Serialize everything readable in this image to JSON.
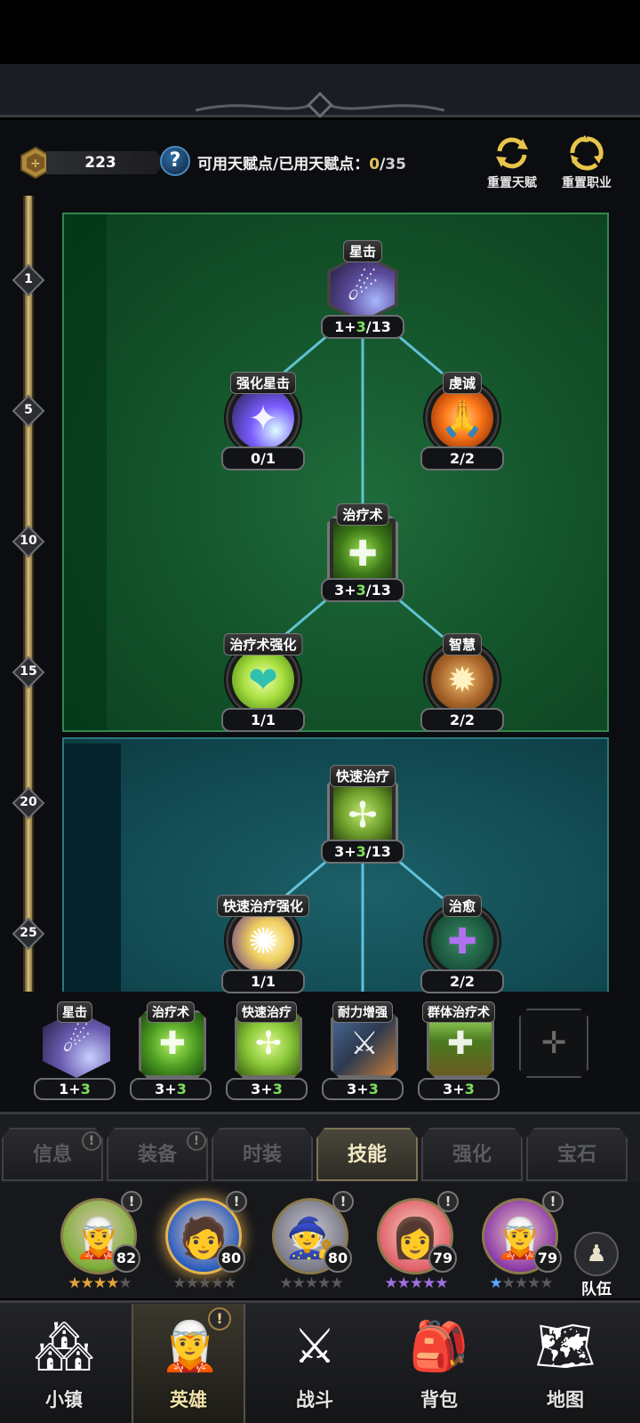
{
  "header": {
    "talent_points": "223",
    "help_icon": "question-icon",
    "talent_label": "可用天赋点/已用天赋点：",
    "available": "0",
    "separator": "/",
    "total": "35",
    "reset_talent": "重置天赋",
    "reset_class": "重置职业"
  },
  "levels": [
    "1",
    "5",
    "10",
    "15",
    "20",
    "25"
  ],
  "tree": {
    "nodes": [
      {
        "name": "星击",
        "base": "1+",
        "add": "3",
        "max": "/13",
        "icon": "meteor-icon",
        "colors": [
          "#2a2340",
          "#7f8dff"
        ]
      },
      {
        "name": "强化星击",
        "count": "0/1",
        "icon": "starfall-icon",
        "colors": [
          "#1d1a3a",
          "#7a5cff"
        ]
      },
      {
        "name": "虔诚",
        "count": "2/2",
        "icon": "praying-hands-icon",
        "colors": [
          "#7a1c00",
          "#ff7a1a"
        ]
      },
      {
        "name": "治疗术",
        "base": "3+",
        "add": "3",
        "max": "/13",
        "icon": "heal-cross-icon",
        "colors": [
          "#1f3d10",
          "#6fbf2a"
        ]
      },
      {
        "name": "治疗术强化",
        "count": "1/1",
        "icon": "heart-cross-icon",
        "colors": [
          "#3e7a10",
          "#c8f060"
        ]
      },
      {
        "name": "智慧",
        "count": "2/2",
        "icon": "book-icon",
        "colors": [
          "#5a3410",
          "#e8a24a"
        ]
      },
      {
        "name": "快速治疗",
        "base": "3+",
        "add": "3",
        "max": "/13",
        "icon": "fast-heal-icon",
        "colors": [
          "#2a4010",
          "#9cd03a"
        ]
      },
      {
        "name": "快速治疗强化",
        "count": "1/1",
        "icon": "radiant-hand-icon",
        "colors": [
          "#5a2f8a",
          "#fff0a0"
        ]
      },
      {
        "name": "治愈",
        "count": "2/2",
        "icon": "purple-cross-icon",
        "colors": [
          "#17503a",
          "#a060e0"
        ]
      }
    ]
  },
  "skillbar": [
    {
      "name": "星击",
      "base": "1+",
      "add": "3",
      "icon": "meteor-icon",
      "colors": [
        "#2a2340",
        "#8a8fff"
      ]
    },
    {
      "name": "治疗术",
      "base": "3+",
      "add": "3",
      "icon": "heal-cross-icon",
      "colors": [
        "#1f4d10",
        "#7ad03a"
      ]
    },
    {
      "name": "快速治疗",
      "base": "3+",
      "add": "3",
      "icon": "fast-heal-icon",
      "colors": [
        "#3a6010",
        "#b8e050"
      ]
    },
    {
      "name": "耐力增强",
      "base": "3+",
      "add": "3",
      "icon": "armored-knight-icon",
      "colors": [
        "#2d3a50",
        "#c07a3a"
      ]
    },
    {
      "name": "群体治疗术",
      "base": "3+",
      "add": "3",
      "icon": "group-heal-icon",
      "colors": [
        "#2a3a10",
        "#d0b040"
      ]
    }
  ],
  "empty_slot_icon": "crosshair-icon",
  "tabs": [
    "信息",
    "装备",
    "时装",
    "技能",
    "强化",
    "宝石"
  ],
  "active_tab": "技能",
  "heroes": [
    {
      "level": "82",
      "stars": 4,
      "star_color": "gold",
      "hair": "#7fae3a",
      "icon": "elf-archer-portrait"
    },
    {
      "level": "80",
      "stars": 0,
      "star_color": "gold",
      "hair": "#2a5cc0",
      "icon": "blue-haired-hero-portrait"
    },
    {
      "level": "80",
      "stars": 0,
      "star_color": "gold",
      "hair": "#9a9aa8",
      "icon": "pale-mage-portrait"
    },
    {
      "level": "79",
      "stars": 5,
      "star_color": "purple",
      "hair": "#e0606a",
      "icon": "red-haired-heroine-portrait"
    },
    {
      "level": "79",
      "stars": 1,
      "star_color": "blue",
      "hair": "#8a3aa8",
      "icon": "purple-elf-portrait"
    }
  ],
  "team_label": "队伍",
  "nav": [
    {
      "label": "小镇",
      "icon": "town-icon"
    },
    {
      "label": "英雄",
      "icon": "hero-icon"
    },
    {
      "label": "战斗",
      "icon": "crossed-swords-icon"
    },
    {
      "label": "背包",
      "icon": "backpack-icon"
    },
    {
      "label": "地图",
      "icon": "map-scroll-icon"
    }
  ],
  "active_nav": "英雄",
  "colors": {
    "panel_top": "#125129",
    "panel_bottom": "#124a52",
    "accent_green": "#7fe05c",
    "gold": "#e4c15a"
  }
}
